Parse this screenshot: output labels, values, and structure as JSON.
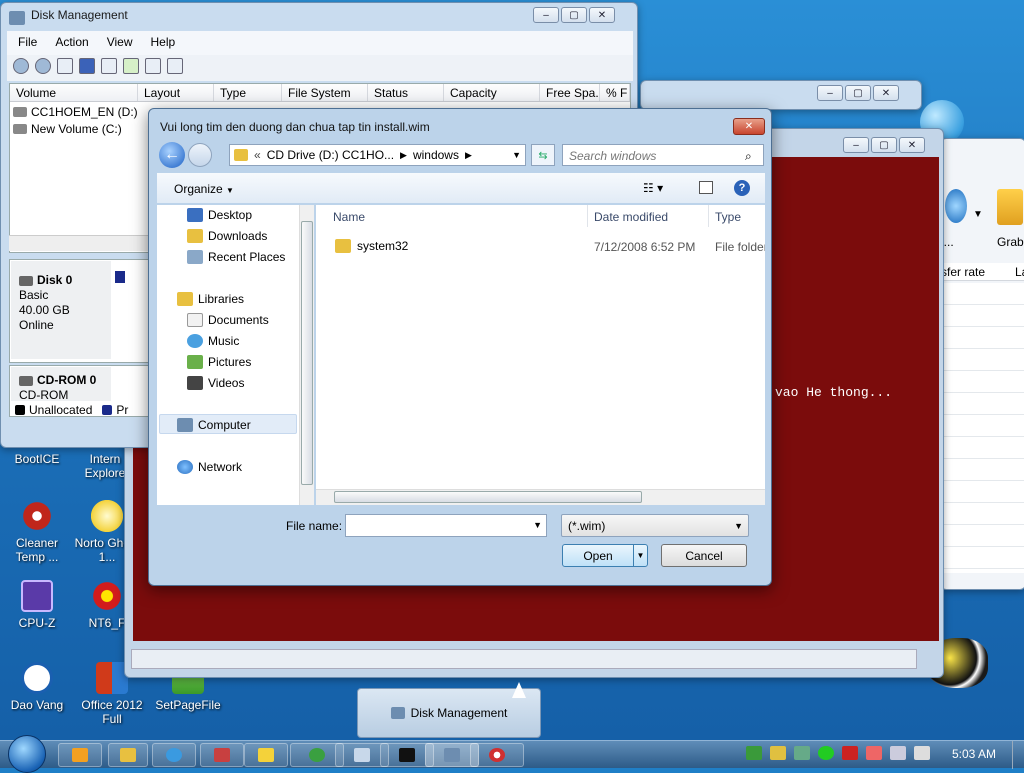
{
  "disk_mgmt": {
    "title": "Disk Management",
    "menu": [
      "File",
      "Action",
      "View",
      "Help"
    ],
    "columns": [
      "Volume",
      "Layout",
      "Type",
      "File System",
      "Status",
      "Capacity",
      "Free Spa...",
      "% F"
    ],
    "volumes": [
      "CC1HOEM_EN (D:)",
      "New Volume (C:)"
    ],
    "disk0": {
      "name": "Disk 0",
      "type": "Basic",
      "size": "40.00 GB",
      "state": "Online"
    },
    "cdrom0": {
      "name": "CD-ROM 0",
      "type": "CD-ROM"
    },
    "legend_unallocated": "Unallocated",
    "legend_primary": "Pr"
  },
  "back_window": {
    "search_hint": "al",
    "tool_label_1": "u...",
    "tool_label_2": "Grabb",
    "col_1": "sfer rate",
    "col_2": "La"
  },
  "console": {
    "text": "vao He thong..."
  },
  "dialog": {
    "title": "Vui long tim den duong dan chua tap tin install.wim",
    "breadcrumb": [
      "CD Drive (D:) CC1HO...",
      "windows"
    ],
    "search_placeholder": "Search windows",
    "organize": "Organize",
    "nav": {
      "favorites": [
        "Desktop",
        "Downloads",
        "Recent Places"
      ],
      "libraries": "Libraries",
      "library_items": [
        "Documents",
        "Music",
        "Pictures",
        "Videos"
      ],
      "computer": "Computer",
      "network": "Network"
    },
    "columns": {
      "name": "Name",
      "date": "Date modified",
      "type": "Type"
    },
    "files": [
      {
        "name": "system32",
        "date": "7/12/2008 6:52 PM",
        "type": "File folder"
      }
    ],
    "file_name_label": "File name:",
    "file_name_value": "",
    "filter": "(*.wim)",
    "open": "Open",
    "cancel": "Cancel"
  },
  "desktop_icons": [
    "BootICE",
    "Intern Explore",
    "Cleaner Temp ...",
    "Norto Ghost 1...",
    "CPU-Z",
    "NT6_F",
    "Dao Vang",
    "Office 2012 Full",
    "SetPageFile"
  ],
  "task_popup": "Disk Management",
  "clock": "5:03 AM"
}
